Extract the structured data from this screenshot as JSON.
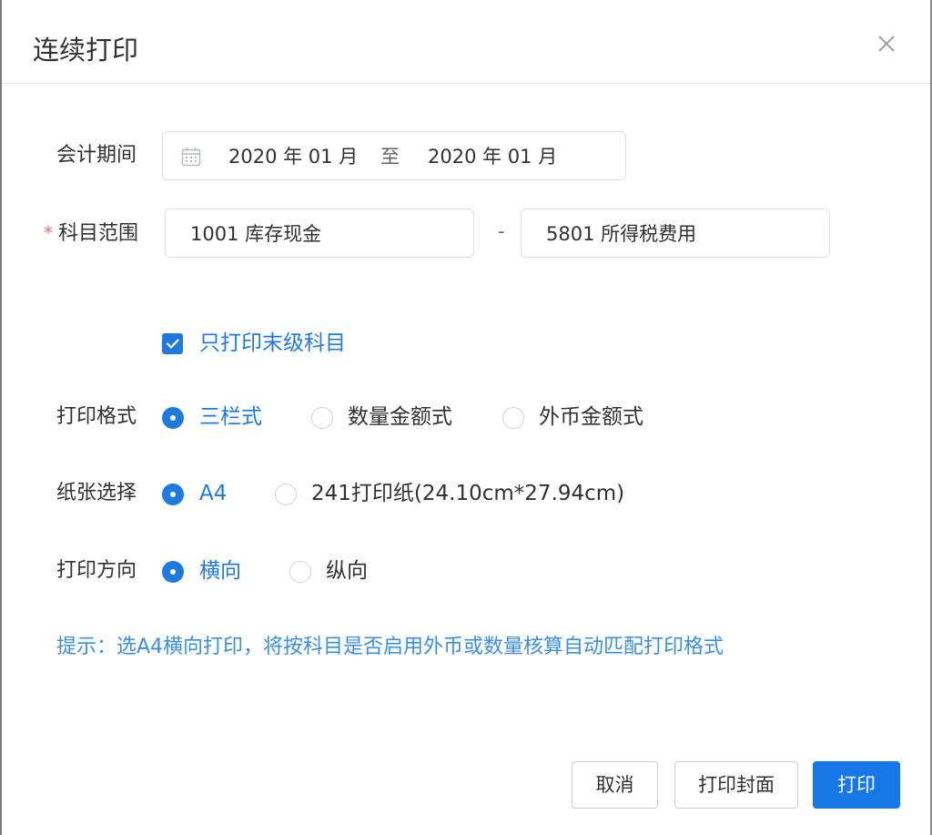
{
  "dialog": {
    "title": "连续打印",
    "close_icon": "close-icon"
  },
  "accounting_period": {
    "label": "会计期间",
    "icon": "calendar-icon",
    "start": "2020 年 01 月",
    "separator": "至",
    "end": "2020 年 01 月"
  },
  "account_range": {
    "required_mark": "*",
    "label": "科目范围",
    "from": "1001 库存现金",
    "separator": "-",
    "to": "5801 所得税费用"
  },
  "leaf_only": {
    "checked": true,
    "label": "只打印末级科目"
  },
  "print_format": {
    "label": "打印格式",
    "options": [
      {
        "label": "三栏式",
        "selected": true
      },
      {
        "label": "数量金额式",
        "selected": false
      },
      {
        "label": "外币金额式",
        "selected": false
      }
    ]
  },
  "paper": {
    "label": "纸张选择",
    "options": [
      {
        "label": "A4",
        "selected": true
      },
      {
        "label": "241打印纸(24.10cm*27.94cm)",
        "selected": false
      }
    ]
  },
  "orientation": {
    "label": "打印方向",
    "options": [
      {
        "label": "横向",
        "selected": true
      },
      {
        "label": "纵向",
        "selected": false
      }
    ]
  },
  "hint": "提示：选A4横向打印，将按科目是否启用外币或数量核算自动匹配打印格式",
  "footer": {
    "cancel_label": "取消",
    "cover_label": "打印封面",
    "print_label": "打印"
  },
  "colors": {
    "primary": "#1677e6",
    "hint": "#3a8ee6",
    "required": "#f56c6c"
  }
}
